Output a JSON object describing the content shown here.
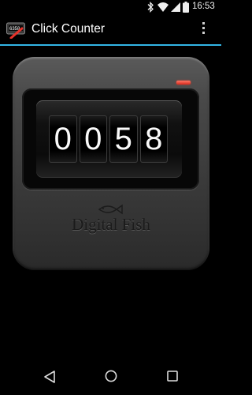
{
  "status_bar": {
    "time": "16:53",
    "icons": [
      "bluetooth-icon",
      "wifi-icon",
      "cell-signal-icon",
      "battery-icon"
    ]
  },
  "app_bar": {
    "title": "Click Counter",
    "app_icon": "counter-app-icon",
    "overflow_icon": "overflow-menu-icon",
    "accent_color": "#33b5e5"
  },
  "counter": {
    "digits": [
      "0",
      "0",
      "5",
      "8"
    ],
    "brand": "Digital Fish",
    "brand_icon": "fish-logo-icon",
    "reset_indicator_color": "#d8291b"
  },
  "nav_bar": {
    "icons": [
      "back-icon",
      "home-icon",
      "recents-icon"
    ]
  }
}
